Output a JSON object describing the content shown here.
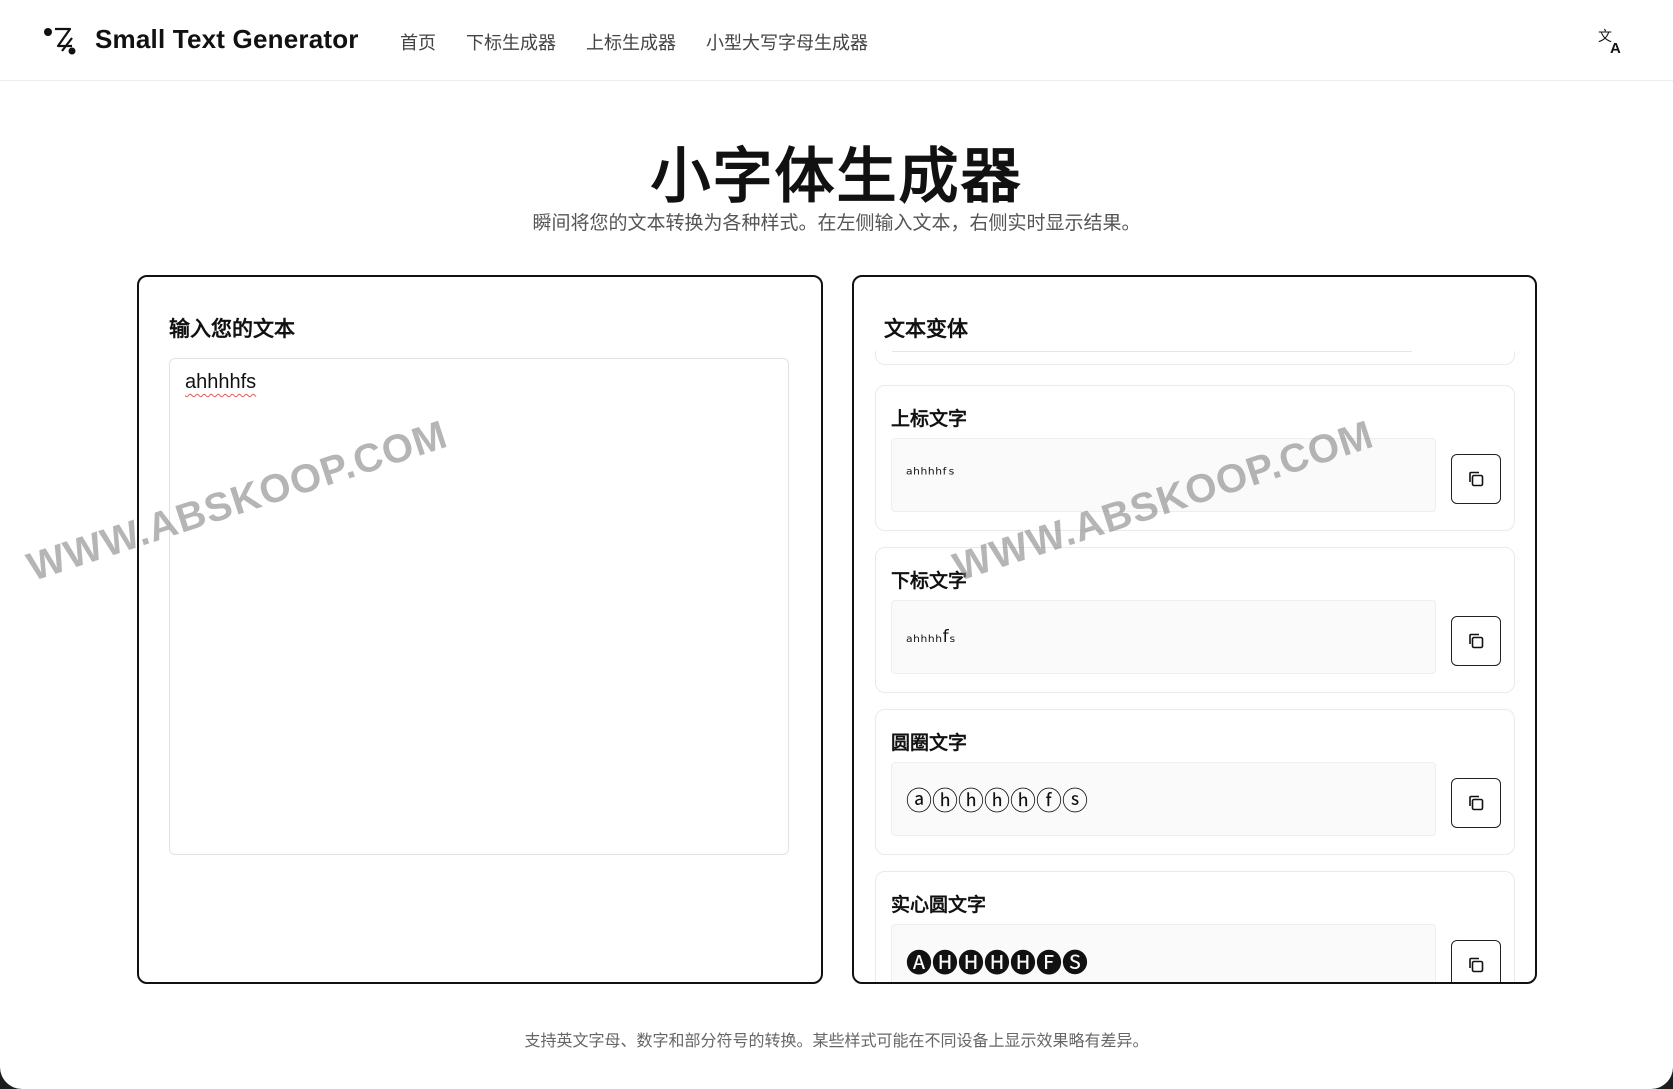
{
  "header": {
    "brand": "Small Text Generator",
    "nav": [
      "首页",
      "下标生成器",
      "上标生成器",
      "小型大写字母生成器"
    ],
    "translate_icon": "translate-icon"
  },
  "hero": {
    "title": "小字体生成器",
    "subtitle": "瞬间将您的文本转换为各种样式。在左侧输入文本，右侧实时显示结果。"
  },
  "input_panel": {
    "title": "输入您的文本",
    "value": "ahhhhfs"
  },
  "variants_panel": {
    "title": "文本变体",
    "items": [
      {
        "label": "上标文字",
        "output": "ᵃʰʰʰʰᶠˢ",
        "style": "plain"
      },
      {
        "label": "下标文字",
        "output": "ₐₕₕₕₕfₛ",
        "style": "plain"
      },
      {
        "label": "圆圈文字",
        "output": "ⓐⓗⓗⓗⓗⓕⓢ",
        "style": "circled"
      },
      {
        "label": "实心圆文字",
        "output": "🅐🅗🅗🅗🅗🅕🅢",
        "style": "circled"
      }
    ],
    "copy_icon": "copy-icon"
  },
  "footer": {
    "note": "支持英文字母、数字和部分符号的转换。某些样式可能在不同设备上显示效果略有差异。"
  },
  "watermark": "WWW.ABSKOOP.COM",
  "colors": {
    "border": "#111111",
    "background": "#ffffff",
    "muted_text": "#555555"
  }
}
